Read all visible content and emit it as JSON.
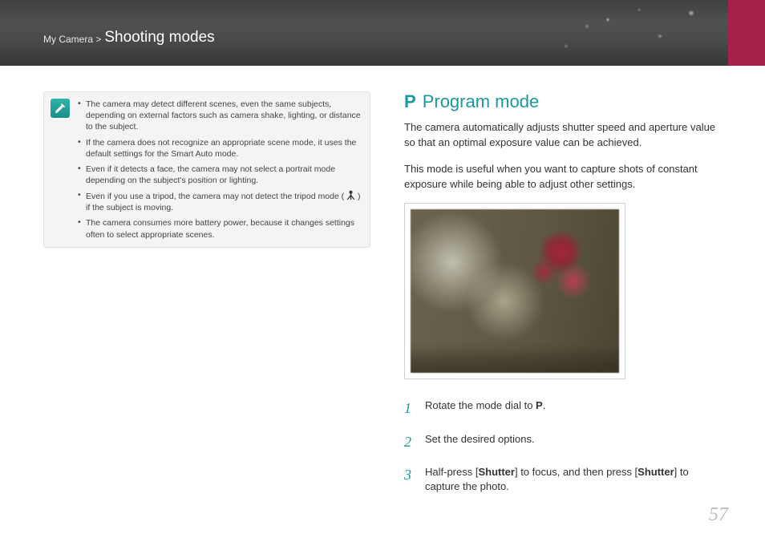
{
  "header": {
    "breadcrumb_prefix": "My Camera > ",
    "breadcrumb_title": "Shooting modes"
  },
  "note": {
    "icon_name": "pencil-note-icon",
    "items": [
      "The camera may detect different scenes, even the same subjects, depending on external factors such as camera shake, lighting, or distance to the subject.",
      "If the camera does not recognize an appropriate scene mode, it uses the default settings for the Smart Auto mode.",
      "Even if it detects a face, the camera may not select a portrait mode depending on the subject's position or lighting.",
      {
        "pre": "Even if you use a tripod, the camera may not detect the tripod mode (",
        "post": ") if the subject is moving.",
        "icon_label": "tripod-icon"
      },
      "The camera consumes more battery power, because it changes settings often to select appropriate scenes."
    ]
  },
  "section": {
    "mode_letter": "P",
    "title": "Program mode",
    "para1": "The camera automatically adjusts shutter speed and aperture value so that an optimal exposure value can be achieved.",
    "para2": "This mode is useful when you want to capture shots of constant exposure while being able to adjust other settings."
  },
  "steps": [
    {
      "num": "1",
      "text_pre": "Rotate the mode dial to ",
      "text_bold": "P",
      "text_post": "."
    },
    {
      "num": "2",
      "text": "Set the desired options."
    },
    {
      "num": "3",
      "text_pre": "Half-press [",
      "b1": "Shutter",
      "mid": "] to focus, and then press [",
      "b2": "Shutter",
      "post": "] to capture the photo."
    }
  ],
  "page_number": "57"
}
